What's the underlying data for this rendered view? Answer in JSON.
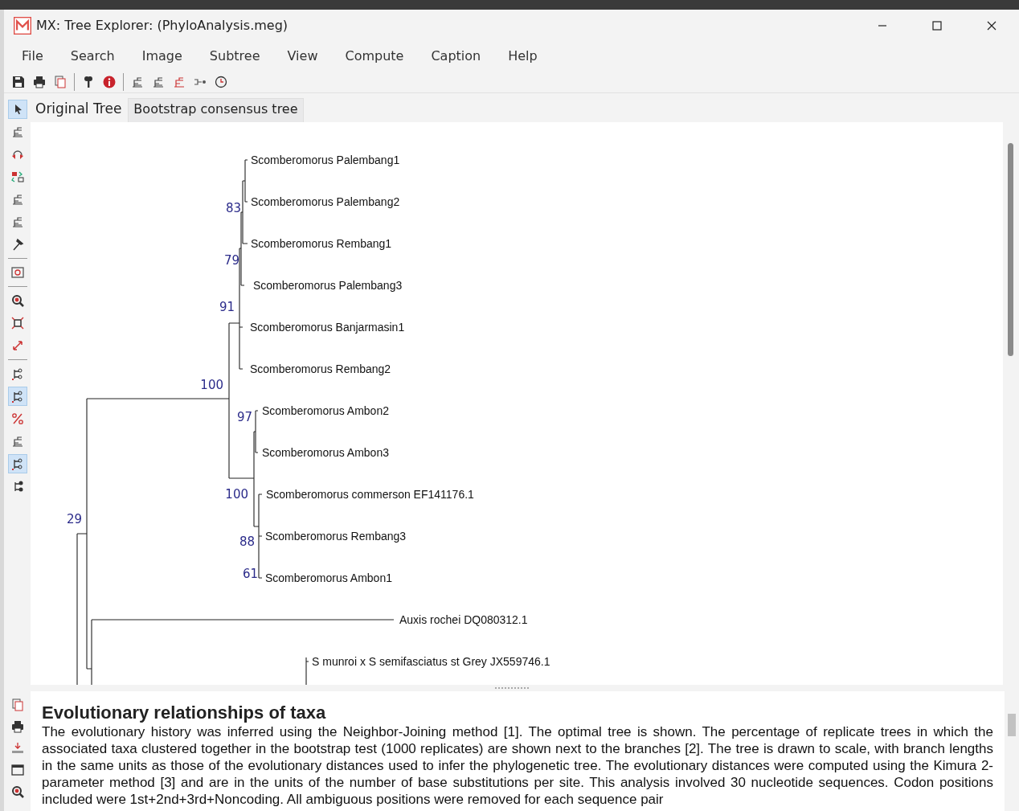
{
  "window": {
    "title": "MX: Tree Explorer: (PhyloAnalysis.meg)"
  },
  "menu": [
    "File",
    "Search",
    "Image",
    "Subtree",
    "View",
    "Compute",
    "Caption",
    "Help"
  ],
  "left_toolbar": [
    {
      "selected": true
    },
    {
      "selected": false
    },
    {
      "selected": false
    },
    {
      "selected": false
    },
    {
      "selected": false
    },
    {
      "selected": false
    },
    {
      "selected": false
    },
    {
      "selected": false
    },
    {
      "selected": false
    },
    {
      "selected": false
    },
    {
      "selected": false
    },
    {
      "selected": false
    },
    {
      "selected": true
    },
    {
      "selected": false
    },
    {
      "selected": false
    },
    {
      "selected": true
    },
    {
      "selected": false
    }
  ],
  "tabs": [
    {
      "label": "Original Tree",
      "selected": true
    },
    {
      "label": "Bootstrap consensus tree",
      "selected": false
    }
  ],
  "tree": {
    "taxa": [
      "Scomberomorus Palembang1",
      "Scomberomorus Palembang2",
      "Scomberomorus Rembang1",
      "Scomberomorus Palembang3",
      "Scomberomorus Banjarmasin1",
      "Scomberomorus Rembang2",
      "Scomberomorus Ambon2",
      "Scomberomorus Ambon3",
      "Scomberomorus commerson EF141176.1",
      "Scomberomorus Rembang3",
      "Scomberomorus Ambon1",
      "Auxis rochei DQ080312.1",
      "S munroi x S semifasciatus st Grey JX559746.1"
    ],
    "bootstrap": [
      "83",
      "79",
      "91",
      "100",
      "97",
      "100",
      "88",
      "61",
      "29"
    ]
  },
  "caption": {
    "title": "Evolutionary relationships of taxa",
    "text": "The evolutionary history was inferred using the Neighbor-Joining method [1]. The optimal tree is shown. The percentage of replicate trees in which the associated taxa clustered together in the bootstrap test (1000 replicates) are shown next to the branches [2]. The tree is drawn to scale, with branch lengths in the same units as those of the evolutionary distances used to infer the phylogenetic tree. The evolutionary distances were computed using the Kimura 2-parameter method [3] and are in the units of the number of base substitutions per site. This analysis involved 30 nucleotide sequences. Codon positions included were 1st+2nd+3rd+Noncoding. All ambiguous positions were removed for each sequence pair"
  }
}
